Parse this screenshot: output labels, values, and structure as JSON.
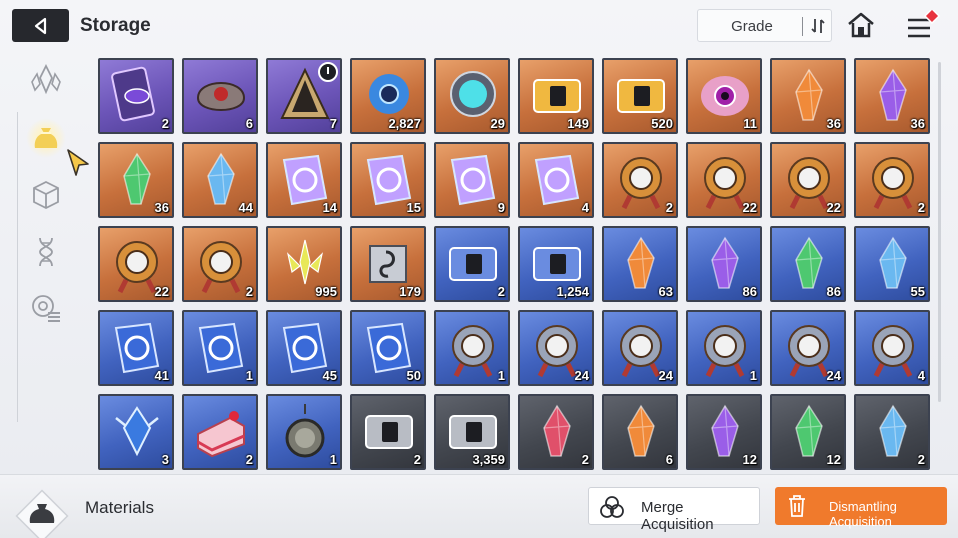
{
  "header": {
    "title": "Storage",
    "grade_label": "Grade"
  },
  "sidebar": {
    "categories": [
      {
        "icon": "crystal-icon",
        "active": false
      },
      {
        "icon": "pouch-icon",
        "active": true
      },
      {
        "icon": "cube-icon",
        "active": false
      },
      {
        "icon": "dna-icon",
        "active": false
      },
      {
        "icon": "target-list-icon",
        "active": false
      }
    ]
  },
  "inventory": {
    "items": [
      {
        "qty": "2",
        "rarity": "purple",
        "icon": "dimension-card-icon"
      },
      {
        "qty": "6",
        "rarity": "purple",
        "icon": "core-shell-icon"
      },
      {
        "qty": "7",
        "rarity": "purple",
        "icon": "pyramid-icon",
        "timer": true
      },
      {
        "qty": "2,827",
        "rarity": "orange",
        "icon": "nebula-orb-icon"
      },
      {
        "qty": "29",
        "rarity": "orange",
        "icon": "capsule-icon"
      },
      {
        "qty": "149",
        "rarity": "orange",
        "icon": "gold-ticket-icon"
      },
      {
        "qty": "520",
        "rarity": "orange",
        "icon": "gold-ticket-star-icon"
      },
      {
        "qty": "11",
        "rarity": "orange",
        "icon": "eye-core-icon"
      },
      {
        "qty": "36",
        "rarity": "orange",
        "icon": "orange-crystal-icon"
      },
      {
        "qty": "36",
        "rarity": "orange",
        "icon": "violet-crystal-icon"
      },
      {
        "qty": "36",
        "rarity": "orange",
        "icon": "green-crystal-icon"
      },
      {
        "qty": "44",
        "rarity": "orange",
        "icon": "blue-crystal-icon"
      },
      {
        "qty": "14",
        "rarity": "orange",
        "icon": "skill-book-icon"
      },
      {
        "qty": "15",
        "rarity": "orange",
        "icon": "skill-book-shield-icon"
      },
      {
        "qty": "9",
        "rarity": "orange",
        "icon": "skill-book-icon"
      },
      {
        "qty": "4",
        "rarity": "orange",
        "icon": "skill-book-bolt-icon"
      },
      {
        "qty": "2",
        "rarity": "orange",
        "icon": "medal-icon"
      },
      {
        "qty": "22",
        "rarity": "orange",
        "icon": "medal-shield-icon"
      },
      {
        "qty": "22",
        "rarity": "orange",
        "icon": "medal-eye-icon"
      },
      {
        "qty": "2",
        "rarity": "orange",
        "icon": "medal-icon"
      },
      {
        "qty": "22",
        "rarity": "orange",
        "icon": "medal-bolt-icon"
      },
      {
        "qty": "2",
        "rarity": "orange",
        "icon": "medal-target-icon"
      },
      {
        "qty": "995",
        "rarity": "orange",
        "icon": "leaf-shard-icon"
      },
      {
        "qty": "179",
        "rarity": "orange",
        "icon": "music-scroll-icon"
      },
      {
        "qty": "2",
        "rarity": "blue",
        "icon": "blue-ticket-icon"
      },
      {
        "qty": "1,254",
        "rarity": "blue",
        "icon": "blue-ticket-star-icon"
      },
      {
        "qty": "63",
        "rarity": "blue",
        "icon": "orange-crystal-icon"
      },
      {
        "qty": "86",
        "rarity": "blue",
        "icon": "violet-crystal-icon"
      },
      {
        "qty": "86",
        "rarity": "blue",
        "icon": "green-crystal-icon"
      },
      {
        "qty": "55",
        "rarity": "blue",
        "icon": "blue-crystal-icon"
      },
      {
        "qty": "41",
        "rarity": "blue",
        "icon": "blue-book-icon"
      },
      {
        "qty": "1",
        "rarity": "blue",
        "icon": "blue-book-icon"
      },
      {
        "qty": "45",
        "rarity": "blue",
        "icon": "blue-book-icon"
      },
      {
        "qty": "50",
        "rarity": "blue",
        "icon": "blue-book-target-icon"
      },
      {
        "qty": "1",
        "rarity": "blue",
        "icon": "silver-medal-icon"
      },
      {
        "qty": "24",
        "rarity": "blue",
        "icon": "silver-medal-shield-icon"
      },
      {
        "qty": "24",
        "rarity": "blue",
        "icon": "silver-medal-eye-icon"
      },
      {
        "qty": "1",
        "rarity": "blue",
        "icon": "silver-medal-icon"
      },
      {
        "qty": "24",
        "rarity": "blue",
        "icon": "silver-medal-bolt-icon"
      },
      {
        "qty": "4",
        "rarity": "blue",
        "icon": "silver-medal-target-icon"
      },
      {
        "qty": "3",
        "rarity": "blue",
        "icon": "frost-gem-icon"
      },
      {
        "qty": "2",
        "rarity": "blue",
        "icon": "cake-icon"
      },
      {
        "qty": "1",
        "rarity": "blue",
        "icon": "pocket-watch-icon"
      },
      {
        "qty": "2",
        "rarity": "gray",
        "icon": "silver-ticket-icon"
      },
      {
        "qty": "3,359",
        "rarity": "gray",
        "icon": "silver-ticket-star-icon"
      },
      {
        "qty": "2",
        "rarity": "gray",
        "icon": "red-crystal-icon"
      },
      {
        "qty": "6",
        "rarity": "gray",
        "icon": "orange-crystal-icon"
      },
      {
        "qty": "12",
        "rarity": "gray",
        "icon": "violet-crystal-icon"
      },
      {
        "qty": "12",
        "rarity": "gray",
        "icon": "green-crystal-icon"
      },
      {
        "qty": "2",
        "rarity": "gray",
        "icon": "blue-crystal-icon"
      }
    ]
  },
  "footer": {
    "category_label": "Materials",
    "merge_label": "Merge Acquisition",
    "dismantle_label": "Dismantling Acquisition"
  },
  "colors": {
    "accent": "#f07a2c",
    "orange_rarity": "#c7703c",
    "purple_rarity": "#6c55b8",
    "blue_rarity": "#4163bf",
    "gray_rarity": "#43474f"
  }
}
